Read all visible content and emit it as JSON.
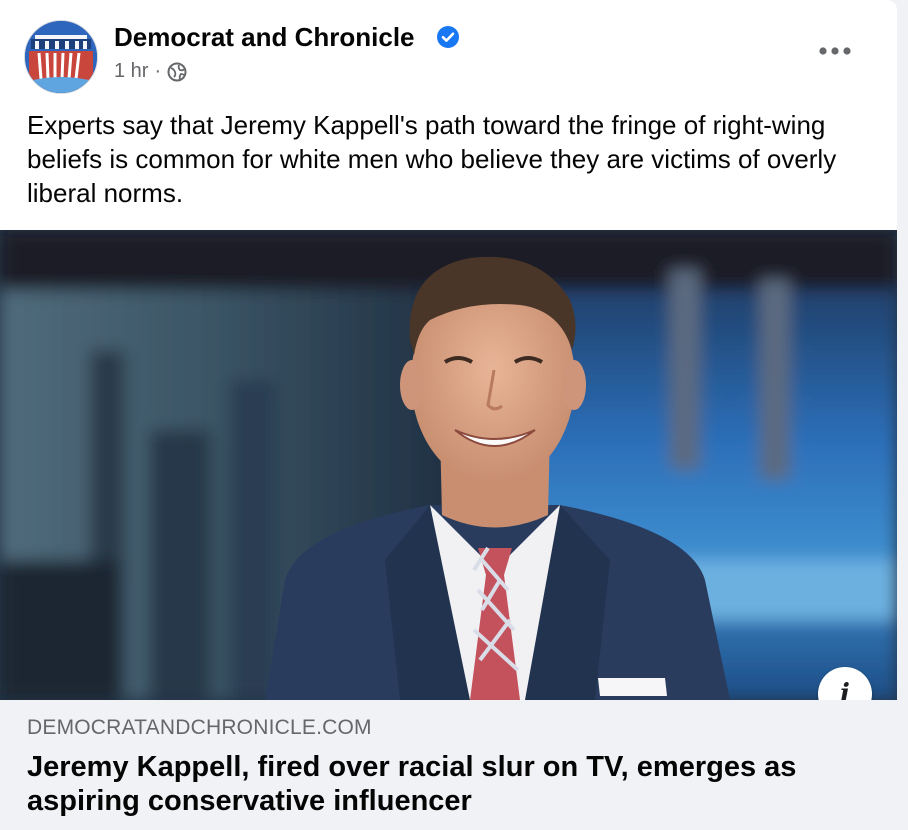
{
  "post": {
    "page_name": "Democrat and Chronicle",
    "verified_icon": "verified-badge-icon",
    "timestamp": "1 hr",
    "separator": "·",
    "audience_icon": "globe-icon",
    "more_icon": "more-options-icon",
    "text": "Experts say that Jeremy Kappell's path toward the fringe of right-wing beliefs is common for white men who believe they are victims of overly liberal norms."
  },
  "link_preview": {
    "image_description_icon": "info-icon",
    "info_label": "i",
    "domain": "DEMOCRATANDCHRONICLE.COM",
    "title": "Jeremy Kappell, fired over racial slur on TV, emerges as aspiring conservative influencer"
  },
  "colors": {
    "verified_blue": "#1877f2",
    "secondary_text": "#65676b",
    "link_background": "#f0f2f5"
  }
}
